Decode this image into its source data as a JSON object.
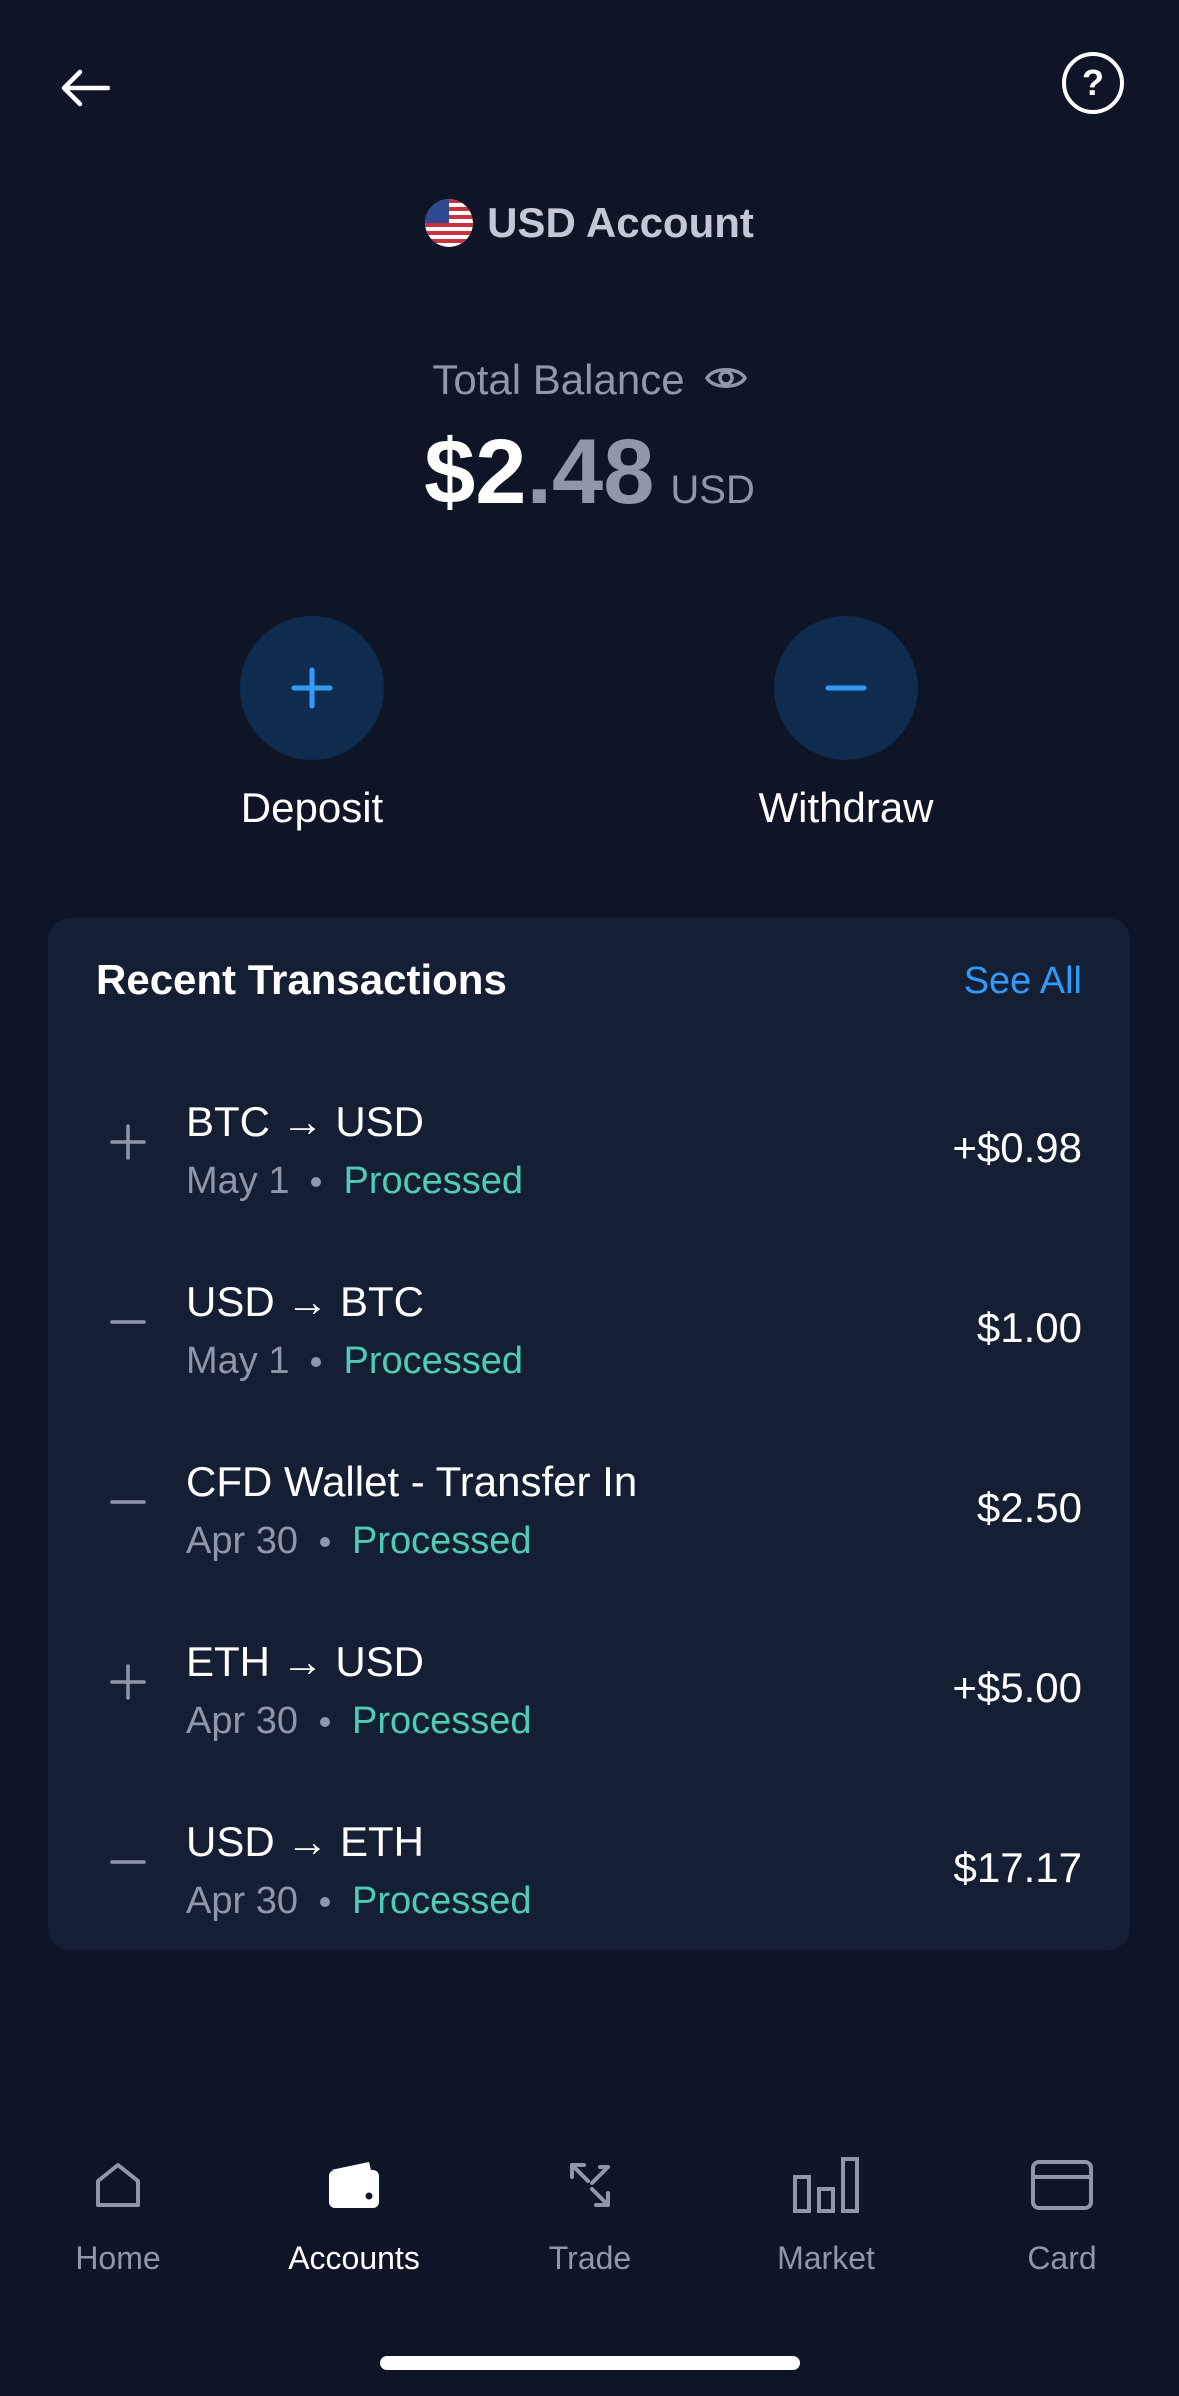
{
  "header": {
    "account_title": "USD Account",
    "flag_icon": "us-flag-icon",
    "back_icon": "arrow-left-icon",
    "help_icon": "question-circle-icon"
  },
  "balance": {
    "label": "Total Balance",
    "whole": "$2",
    "cents": ".48",
    "currency": "USD"
  },
  "actions": {
    "deposit_label": "Deposit",
    "withdraw_label": "Withdraw"
  },
  "transactions": {
    "title": "Recent Transactions",
    "see_all_label": "See All",
    "items": [
      {
        "sign": "+",
        "title": "BTC → USD",
        "date": "May 1",
        "status": "Processed",
        "amount": "+$0.98"
      },
      {
        "sign": "-",
        "title": "USD → BTC",
        "date": "May 1",
        "status": "Processed",
        "amount": "$1.00"
      },
      {
        "sign": "-",
        "title": "CFD Wallet - Transfer In",
        "date": "Apr 30",
        "status": "Processed",
        "amount": "$2.50"
      },
      {
        "sign": "+",
        "title": "ETH → USD",
        "date": "Apr 30",
        "status": "Processed",
        "amount": "+$5.00"
      },
      {
        "sign": "-",
        "title": "USD → ETH",
        "date": "Apr 30",
        "status": "Processed",
        "amount": "$17.17"
      }
    ]
  },
  "nav": {
    "items": [
      {
        "label": "Home",
        "icon": "home-icon"
      },
      {
        "label": "Accounts",
        "icon": "wallet-icon",
        "active": true
      },
      {
        "label": "Trade",
        "icon": "trade-arrows-icon"
      },
      {
        "label": "Market",
        "icon": "bar-chart-icon"
      },
      {
        "label": "Card",
        "icon": "credit-card-icon"
      }
    ]
  },
  "colors": {
    "background": "#0d1526",
    "card": "#151f33",
    "accent": "#2f9bff",
    "status_processed": "#4fcdb3",
    "muted": "#8f97a8"
  }
}
